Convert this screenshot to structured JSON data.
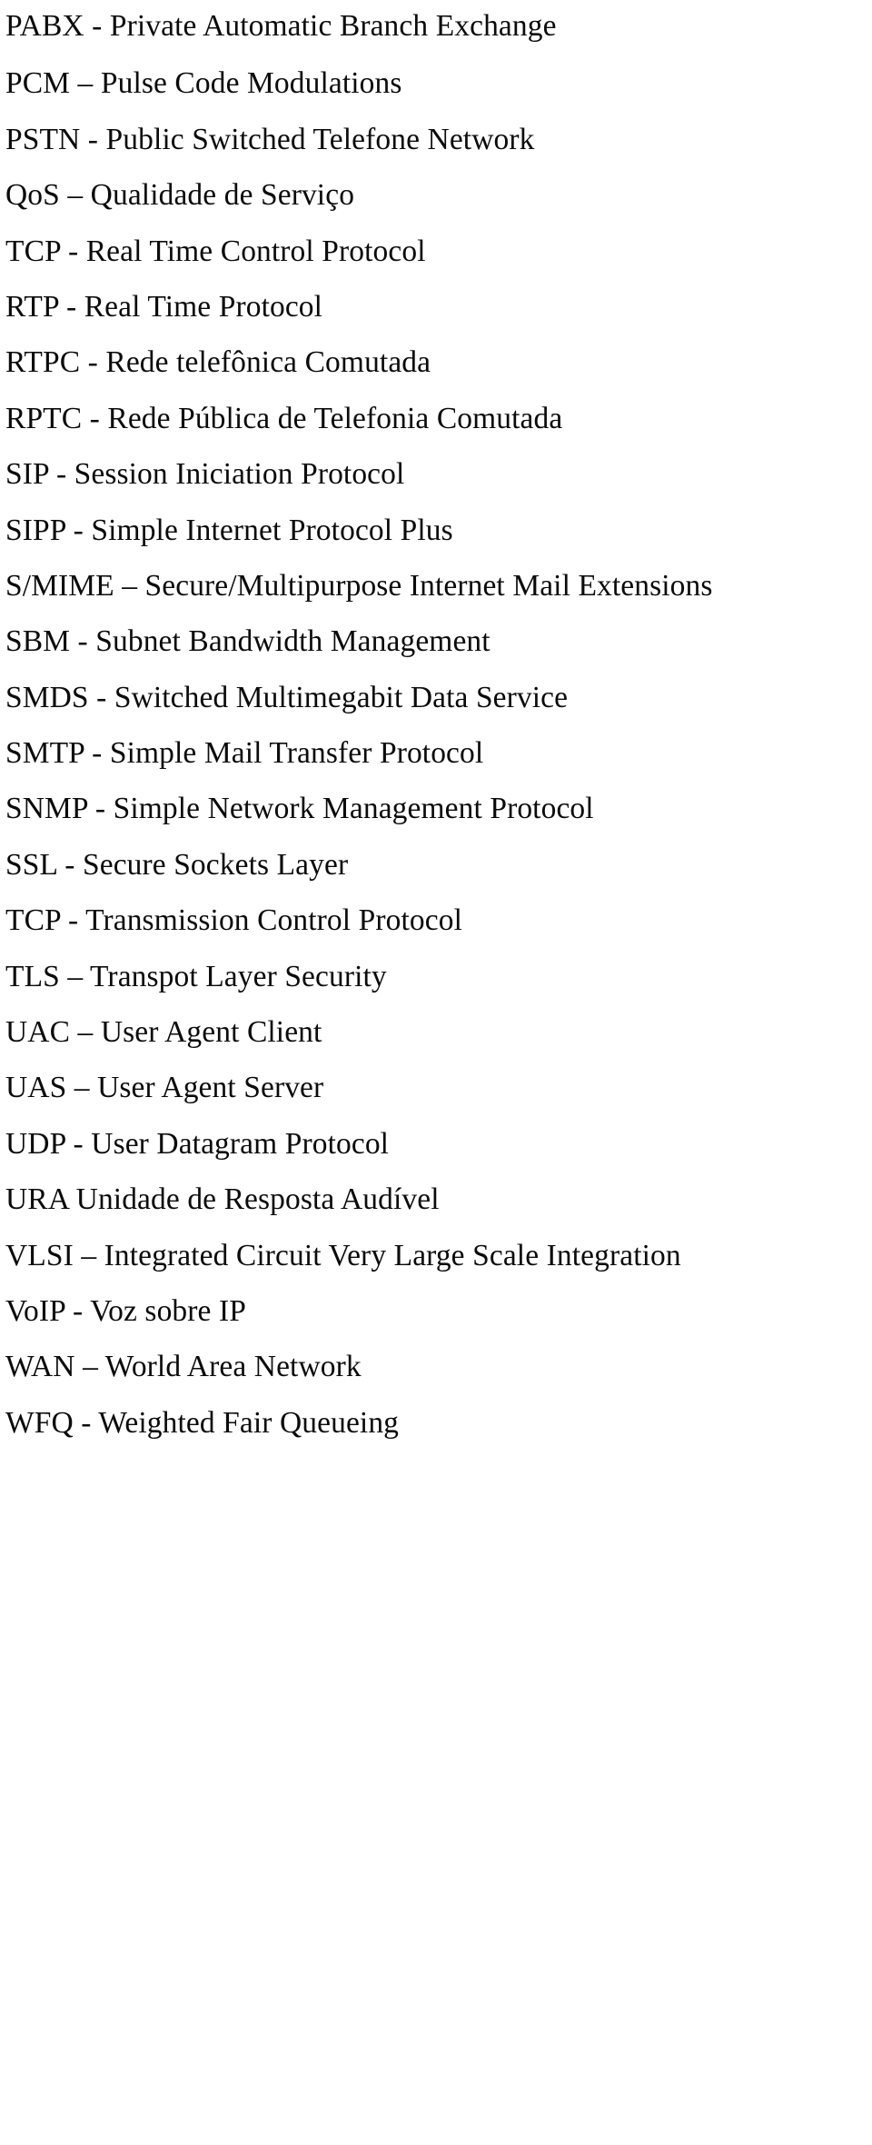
{
  "document": {
    "type": "glossary",
    "page_background": "#ffffff",
    "text_color": "#0b0b0b",
    "entries": [
      {
        "term": "PABX",
        "separator": "-",
        "definition": "Private Automatic Branch Exchange",
        "full": "PABX - Private Automatic Branch Exchange"
      },
      {
        "term": "PCM",
        "separator": "–",
        "definition": "Pulse Code Modulations",
        "full": "PCM – Pulse Code Modulations"
      },
      {
        "term": "PSTN",
        "separator": "-",
        "definition": "Public Switched Telefone Network",
        "full": "PSTN - Public Switched Telefone Network"
      },
      {
        "term": "QoS",
        "separator": "–",
        "definition": "Qualidade de Serviço",
        "full": "QoS – Qualidade de Serviço"
      },
      {
        "term": "TCP",
        "separator": "-",
        "definition": "Real Time Control Protocol",
        "full": "TCP - Real Time Control Protocol"
      },
      {
        "term": "RTP",
        "separator": "-",
        "definition": "Real Time Protocol",
        "full": "RTP - Real Time Protocol"
      },
      {
        "term": "RTPC",
        "separator": "-",
        "definition": "Rede telefônica Comutada",
        "full": "RTPC - Rede telefônica Comutada"
      },
      {
        "term": "RPTC",
        "separator": "-",
        "definition": "Rede Pública de Telefonia Comutada",
        "full": "RPTC - Rede Pública de Telefonia Comutada"
      },
      {
        "term": "SIP",
        "separator": "-",
        "definition": "Session Iniciation Protocol",
        "full": "SIP - Session Iniciation Protocol"
      },
      {
        "term": "SIPP",
        "separator": "-",
        "definition": "Simple Internet Protocol Plus",
        "full": "SIPP - Simple Internet Protocol Plus"
      },
      {
        "term": "S/MIME",
        "separator": "–",
        "definition": "Secure/Multipurpose Internet Mail Extensions",
        "full": "S/MIME – Secure/Multipurpose Internet Mail Extensions"
      },
      {
        "term": "SBM",
        "separator": "-",
        "definition": "Subnet Bandwidth Management",
        "full": "SBM - Subnet Bandwidth Management"
      },
      {
        "term": "SMDS",
        "separator": "-",
        "definition": "Switched Multimegabit Data Service",
        "full": "SMDS - Switched Multimegabit Data Service"
      },
      {
        "term": "SMTP",
        "separator": "-",
        "definition": "Simple Mail Transfer Protocol",
        "full": "SMTP - Simple Mail Transfer Protocol"
      },
      {
        "term": "SNMP",
        "separator": "-",
        "definition": "Simple Network Management Protocol",
        "full": "SNMP - Simple Network Management Protocol"
      },
      {
        "term": "SSL",
        "separator": "-",
        "definition": "Secure Sockets Layer",
        "full": "SSL - Secure Sockets Layer"
      },
      {
        "term": "TCP",
        "separator": "-",
        "definition": "Transmission Control Protocol",
        "full": "TCP - Transmission Control Protocol"
      },
      {
        "term": "TLS",
        "separator": "–",
        "definition": "Transpot Layer Security",
        "full": "TLS – Transpot Layer Security"
      },
      {
        "term": "UAC",
        "separator": "–",
        "definition": "User Agent Client",
        "full": "UAC – User Agent Client"
      },
      {
        "term": "UAS",
        "separator": "–",
        "definition": "User Agent Server",
        "full": "UAS – User Agent Server"
      },
      {
        "term": "UDP",
        "separator": "-",
        "definition": "User Datagram Protocol",
        "full": "UDP - User Datagram Protocol"
      },
      {
        "term": "URA",
        "separator": "",
        "definition": "Unidade de Resposta Audível",
        "full": "URA Unidade de Resposta Audível"
      },
      {
        "term": "VLSI",
        "separator": "–",
        "definition": "Integrated Circuit Very Large Scale Integration",
        "full": "VLSI – Integrated Circuit Very Large Scale Integration"
      },
      {
        "term": "VoIP",
        "separator": "-",
        "definition": "Voz sobre IP",
        "full": "VoIP - Voz sobre IP"
      },
      {
        "term": "WAN",
        "separator": "–",
        "definition": "World Area Network",
        "full": "WAN – World Area Network"
      },
      {
        "term": "WFQ",
        "separator": "-",
        "definition": "Weighted Fair Queueing",
        "full": "WFQ - Weighted Fair Queueing"
      }
    ]
  }
}
